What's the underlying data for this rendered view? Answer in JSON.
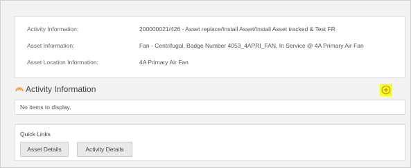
{
  "info": {
    "rows": [
      {
        "label": "Activity Information:",
        "value": "200000021/426 - Asset replace/Install Asset/Install Asset tracked & Test FR"
      },
      {
        "label": "Asset Information:",
        "value": "Fan - Centrifugal, Badge Number 4053_4APRI_FAN, In Service @ 4A Primary Air Fan"
      },
      {
        "label": "Asset Location Information:",
        "value": "4A Primary Air Fan"
      }
    ]
  },
  "section": {
    "title": "Activity Information",
    "empty_message": "No items to display.",
    "accent_color": "#f39c12",
    "add_icon": "plus-circle-icon",
    "add_highlight_color": "#f4ff2a"
  },
  "quick_links": {
    "title": "Quick Links",
    "buttons": [
      "Asset Details",
      "Activity Details"
    ]
  }
}
